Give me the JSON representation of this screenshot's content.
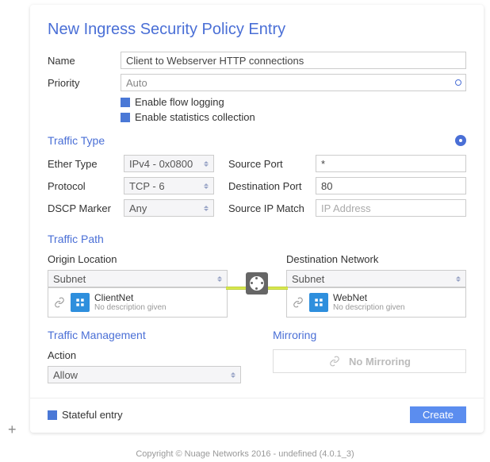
{
  "title": "New Ingress Security Policy Entry",
  "name_label": "Name",
  "name_value": "Client to Webserver HTTP connections",
  "priority_label": "Priority",
  "priority_value": "Auto",
  "enable_flow_logging_label": "Enable flow logging",
  "enable_stats_label": "Enable statistics collection",
  "traffic_type": {
    "title": "Traffic Type",
    "ether_type_label": "Ether Type",
    "ether_type_value": "IPv4 - 0x0800",
    "protocol_label": "Protocol",
    "protocol_value": "TCP - 6",
    "dscp_label": "DSCP Marker",
    "dscp_value": "Any",
    "src_port_label": "Source Port",
    "src_port_value": "*",
    "dst_port_label": "Destination Port",
    "dst_port_value": "80",
    "src_ip_label": "Source IP Match",
    "src_ip_placeholder": "IP Address"
  },
  "traffic_path": {
    "title": "Traffic Path",
    "origin_label": "Origin Location",
    "origin_type": "Subnet",
    "origin_name": "ClientNet",
    "origin_desc": "No description given",
    "dest_label": "Destination Network",
    "dest_type": "Subnet",
    "dest_name": "WebNet",
    "dest_desc": "No description given"
  },
  "management": {
    "title": "Traffic Management",
    "action_label": "Action",
    "action_value": "Allow"
  },
  "mirroring": {
    "title": "Mirroring",
    "none_label": "No Mirroring"
  },
  "stateful_label": "Stateful entry",
  "create_label": "Create",
  "copyright": "Copyright © Nuage Networks 2016 - undefined (4.0.1_3)"
}
